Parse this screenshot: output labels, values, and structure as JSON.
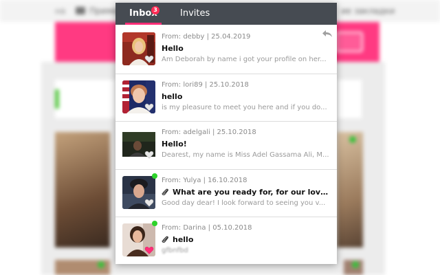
{
  "background": {
    "bookmarks_left": "на",
    "bookmarks_middle": "Пример",
    "bookmarks_right": "ие закладки"
  },
  "popup": {
    "tabs": [
      {
        "label": "Inbox",
        "badge": "3"
      },
      {
        "label": "Invites"
      }
    ],
    "messages": [
      {
        "from": "From: debby | 25.04.2019",
        "subject": "Hello",
        "preview": "Am Deborah by name i got your profile on her...",
        "attachment": false,
        "online": false,
        "liked": false
      },
      {
        "from": "From: lori89 | 25.10.2018",
        "subject": "hello",
        "preview": "is my pleasure to meet you here and if you do...",
        "attachment": false,
        "online": false,
        "liked": false
      },
      {
        "from": "From: adelgali | 25.10.2018",
        "subject": "Hello!",
        "preview": "Dearest, my name is Miss Adel Gassama Ali, M...",
        "attachment": false,
        "online": false,
        "liked": false
      },
      {
        "from": "From: Yulya | 16.10.2018",
        "subject": "What are you ready for, for our love an...",
        "preview": "Good day dear! I look forward to seeing you v...",
        "attachment": true,
        "online": true,
        "liked": false
      },
      {
        "from": "From: Darina | 05.10.2018",
        "subject": "hello",
        "preview": "gfbnfbd",
        "attachment": true,
        "online": true,
        "liked": true
      }
    ]
  },
  "colors": {
    "accent": "#ff2d77",
    "tabbar": "#464b52",
    "online": "#2dd42a"
  }
}
